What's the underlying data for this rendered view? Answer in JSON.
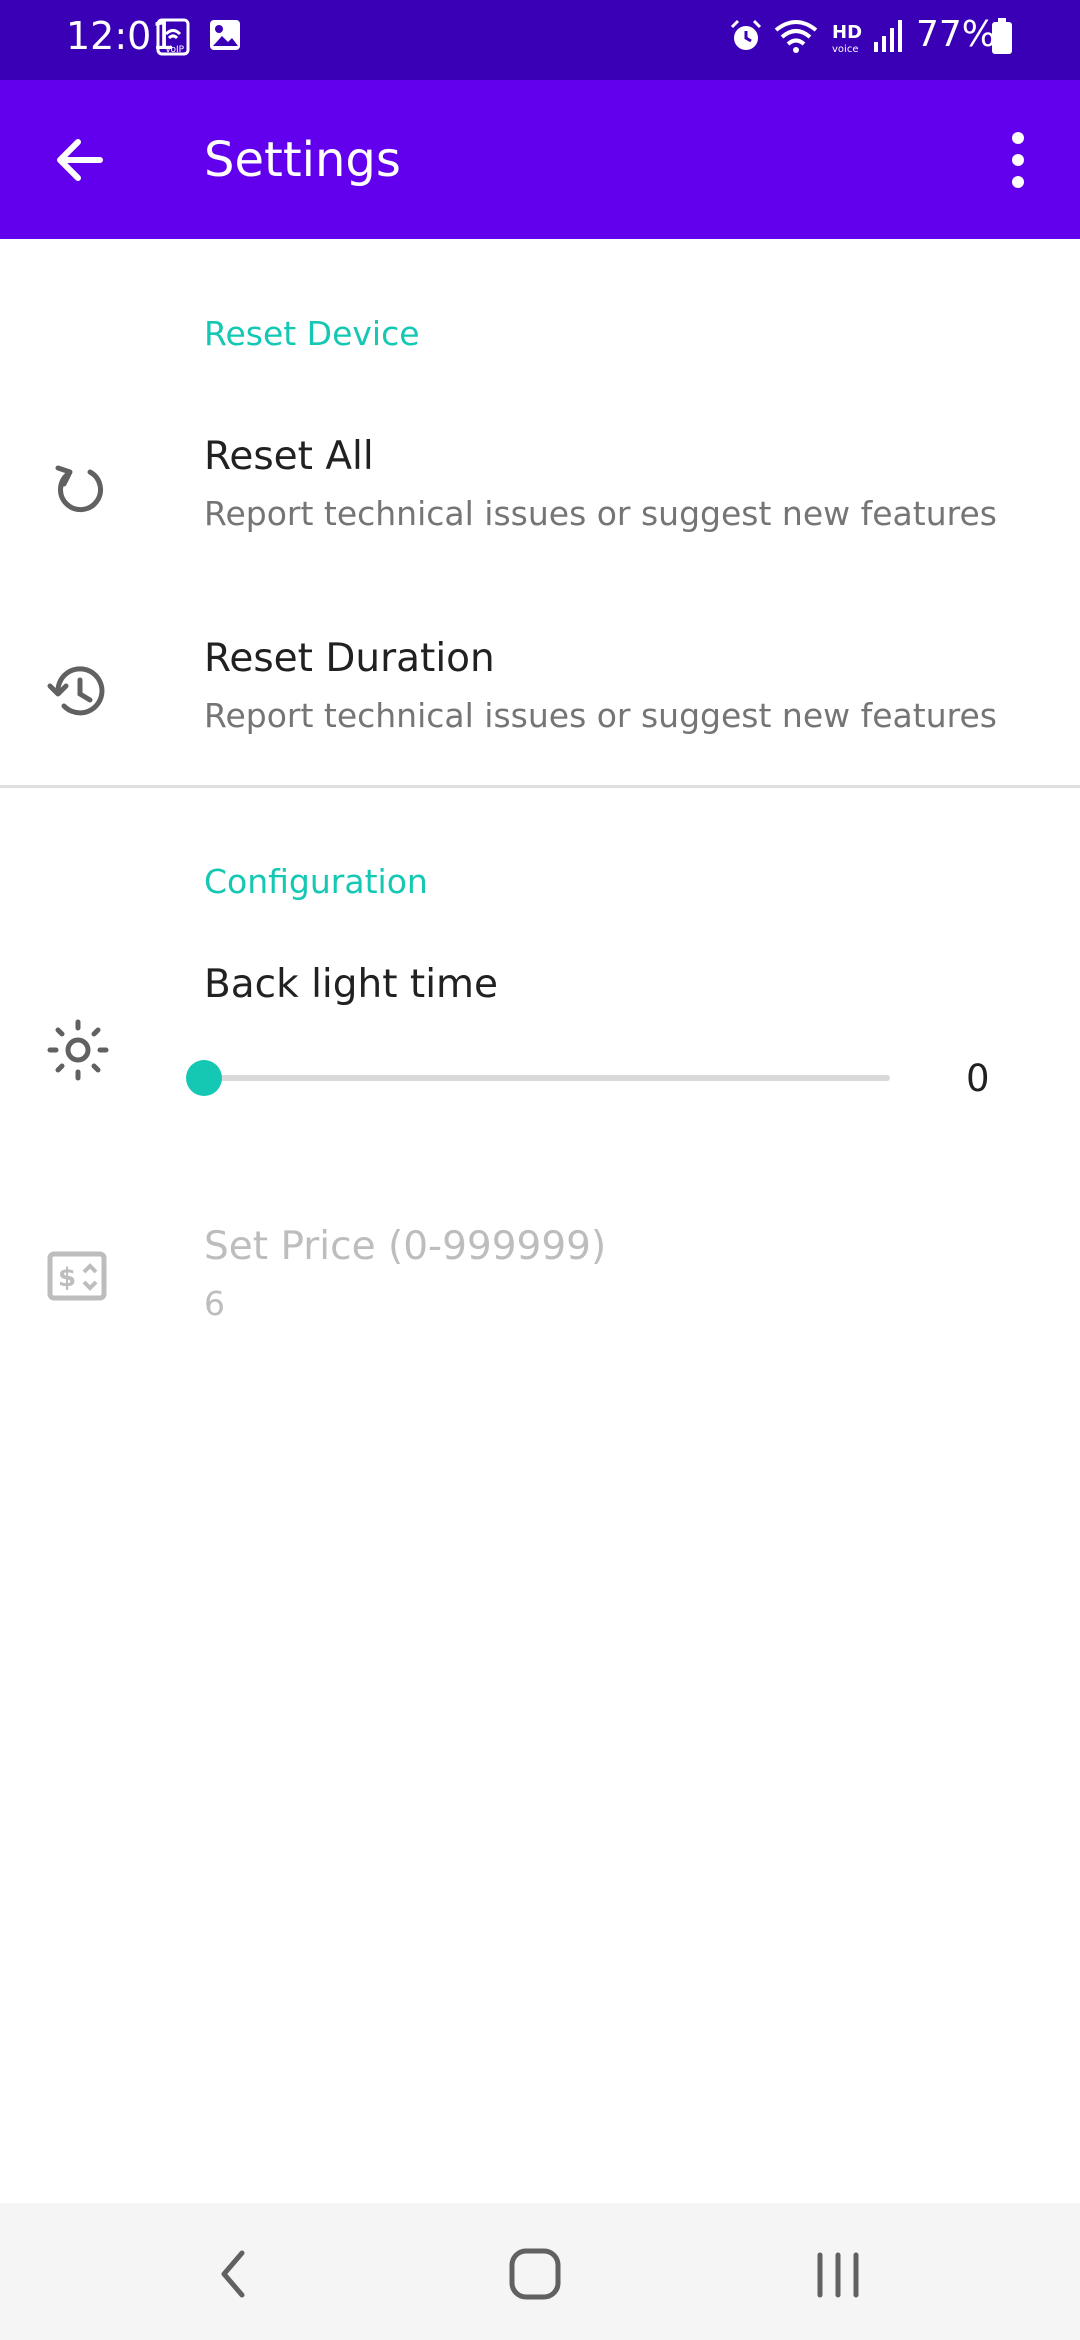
{
  "status_bar": {
    "time": "12:01",
    "battery": "77%",
    "icons": [
      "voip-wifi-icon",
      "image-icon",
      "alarm-icon",
      "wifi-icon",
      "hd-voice-icon",
      "signal-icon",
      "battery-icon"
    ]
  },
  "app_bar": {
    "title": "Settings",
    "back_icon": "arrow-back-icon",
    "menu_icon": "more-vert-icon"
  },
  "sections": {
    "reset": {
      "header": "Reset Device",
      "items": [
        {
          "title": "Reset All",
          "summary": "Report technical issues or suggest new features",
          "icon": "reset-icon"
        },
        {
          "title": "Reset Duration",
          "summary": "Report technical issues or suggest new features",
          "icon": "history-icon"
        }
      ]
    },
    "config": {
      "header": "Configuration",
      "backlight": {
        "title": "Back light time",
        "value": "0",
        "level": 0,
        "icon": "brightness-icon"
      },
      "price": {
        "title": "Set Price (0-999999)",
        "value": "6",
        "enabled": false,
        "icon": "price-tag-icon"
      }
    }
  },
  "nav_bar": {
    "items": [
      "nav-back-icon",
      "nav-home-icon",
      "nav-recents-icon"
    ]
  },
  "colors": {
    "status_bar": "#3a00b5",
    "app_bar": "#6200ee",
    "accent": "#14c8b4"
  }
}
